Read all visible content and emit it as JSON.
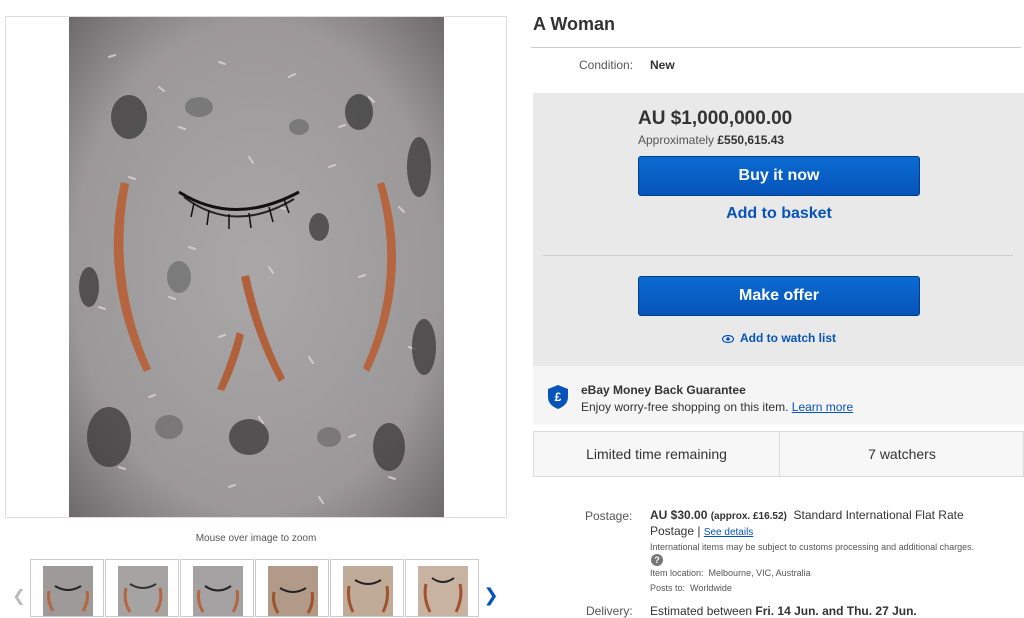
{
  "listing": {
    "title": "A Woman",
    "condition_label": "Condition:",
    "condition_value": "New"
  },
  "gallery": {
    "zoom_hint": "Mouse over image to zoom",
    "prev_icon": "chevron-left-icon",
    "next_icon": "chevron-right-icon",
    "thumbnail_count": 6
  },
  "purchase": {
    "price": "AU $1,000,000.00",
    "approx_label": "Approximately",
    "approx_value": "£550,615.43",
    "buy_now_label": "Buy it now",
    "add_basket_label": "Add to basket",
    "make_offer_label": "Make offer",
    "watch_label": "Add to watch list",
    "button_color": "#0654ba",
    "link_color": "#0654ba"
  },
  "guarantee": {
    "title": "eBay Money Back Guarantee",
    "text": "Enjoy worry-free shopping on this item.",
    "link": "Learn more",
    "icon": "shield-pound-icon",
    "icon_color": "#0654ba"
  },
  "stats": {
    "time_remaining": "Limited time remaining",
    "watchers": "7 watchers"
  },
  "postage": {
    "label": "Postage:",
    "price": "AU $30.00",
    "approx": "(approx. £16.52)",
    "service_part1": "Standard International Flat Rate",
    "service_part2": "Postage |",
    "details_link": "See details",
    "customs_note": "International items may be subject to customs processing and additional charges.",
    "help_icon": "?",
    "location_label": "Item location:",
    "location_value": "Melbourne, VIC, Australia",
    "posts_to_label": "Posts to:",
    "posts_to_value": "Worldwide"
  },
  "delivery": {
    "label": "Delivery:",
    "prefix": "Estimated between",
    "dates": "Fri. 14 Jun. and Thu. 27 Jun."
  }
}
